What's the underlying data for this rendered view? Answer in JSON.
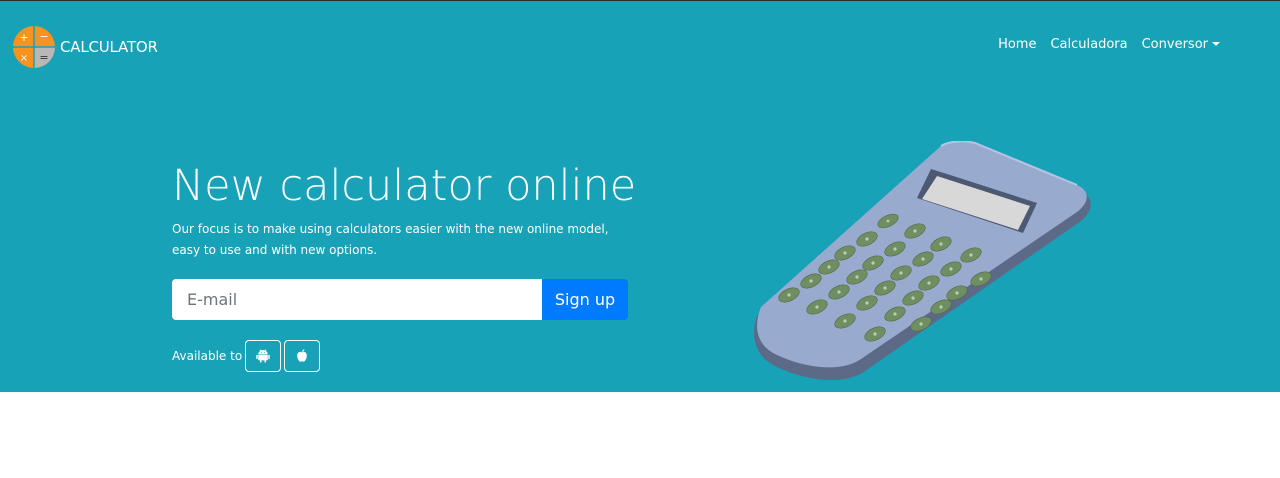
{
  "brand": {
    "name": "CALCULATOR",
    "logo_icon": "calculator-operators-logo",
    "logo_colors": [
      "#f7931e",
      "#b0b0b0"
    ]
  },
  "nav": {
    "items": [
      {
        "label": "Home"
      },
      {
        "label": "Calculadora"
      },
      {
        "label": "Conversor",
        "has_dropdown": true
      }
    ]
  },
  "hero": {
    "title": "New calculator online",
    "description": "Our focus is to make using calculators easier with the new online model, easy to use and with new options.",
    "email_placeholder": "E-mail",
    "email_value": "",
    "signup_label": "Sign up",
    "available_label": "Available to",
    "platforms": [
      {
        "icon": "android-icon"
      },
      {
        "icon": "apple-icon"
      }
    ],
    "illustration": "calculator-illustration"
  },
  "colors": {
    "hero_background": "#17a2b8",
    "primary_button": "#007bff",
    "text": "#ffffff"
  }
}
